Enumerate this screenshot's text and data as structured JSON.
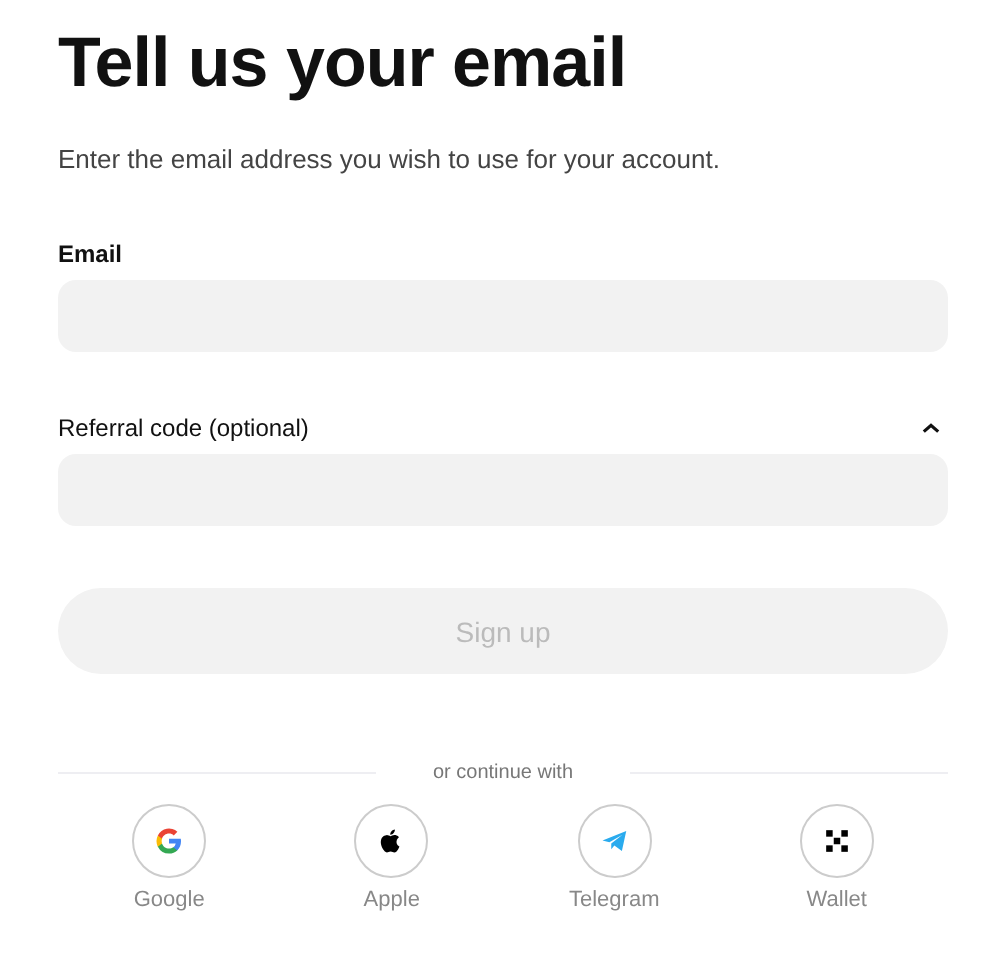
{
  "title": "Tell us your email",
  "subtitle": "Enter the email address you wish to use for your account.",
  "email": {
    "label": "Email"
  },
  "referral": {
    "label": "Referral code (optional)",
    "expanded": true
  },
  "submit": {
    "label": "Sign up",
    "disabled": true
  },
  "divider": "or continue with",
  "providers": [
    {
      "kind": "google",
      "label": "Google"
    },
    {
      "kind": "apple",
      "label": "Apple"
    },
    {
      "kind": "telegram",
      "label": "Telegram"
    },
    {
      "kind": "wallet",
      "label": "Wallet"
    }
  ]
}
